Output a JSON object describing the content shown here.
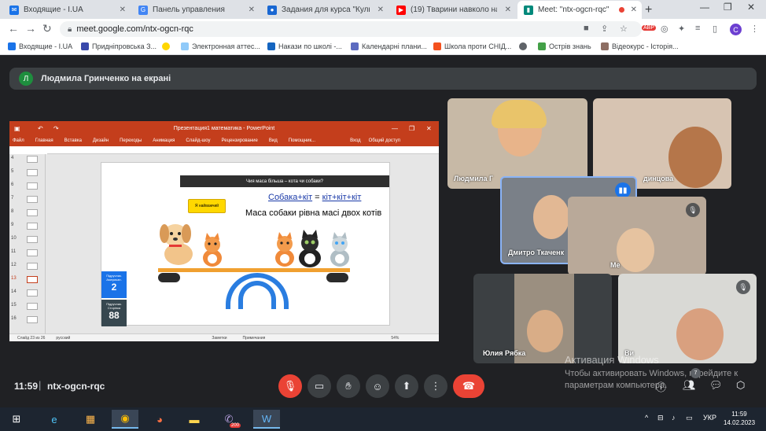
{
  "browser": {
    "tabs": [
      {
        "label": "Входящие - I.UA",
        "color": "#1a73e8",
        "active": false
      },
      {
        "label": "Панель управления",
        "color": "#4285f4",
        "active": false
      },
      {
        "label": "Задания для курса \"Культура",
        "color": "#1967d2",
        "active": false
      },
      {
        "label": "(19) Тварини навколо нас - Yo",
        "color": "#ff0000",
        "active": false
      },
      {
        "label": "Meet: \"ntx-ogcn-rqc\"",
        "color": "#00897b",
        "active": true
      }
    ],
    "new_tab": "+",
    "url": "meet.google.com/ntx-ogcn-rqc",
    "profile_initial": "C",
    "bookmarks": [
      {
        "label": "Входящие - I.UA",
        "color": "#1a73e8"
      },
      {
        "label": "Придніпровська З...",
        "color": "#3949ab"
      },
      {
        "label": "",
        "color": "#ffd600"
      },
      {
        "label": "Электронная аттес...",
        "color": "#90caf9"
      },
      {
        "label": "Накази по школі -...",
        "color": "#1565c0"
      },
      {
        "label": "Календарні плани...",
        "color": "#5c6bc0"
      },
      {
        "label": "Школа проти СНІД...",
        "color": "#f4511e"
      },
      {
        "label": "",
        "color": "#5f6368"
      },
      {
        "label": "Острів знань",
        "color": "#43a047"
      },
      {
        "label": "Відеокурс - Історія...",
        "color": "#8d6e63"
      }
    ]
  },
  "banner": {
    "initial": "Л",
    "text": "Людмила Гринченко на екрані"
  },
  "presentation": {
    "title": "Презентация1 математика - PowerPoint",
    "menu": [
      "Файл",
      "Главная",
      "Вставка",
      "Дизайн",
      "Переходы",
      "Анимация",
      "Слайд-шоу",
      "Рецензирование",
      "Вид",
      "Помощник...",
      "Вход",
      "Общий доступ"
    ],
    "thumb_numbers": [
      "4",
      "5",
      "6",
      "7",
      "8",
      "9",
      "10",
      "11",
      "12",
      "13",
      "14",
      "15",
      "16"
    ],
    "slide": {
      "header": "Чия маса більша – кота чи собаки?",
      "eq_left": "Собака+кіт",
      "eq_mid": " = ",
      "eq_right": "кіт+кіт+кіт",
      "eq_line2": "Маса собаки рівна масі двох котів",
      "bubble": "Я найважчий",
      "counter1_label": "Підручник. Американ.",
      "counter1_value": "2",
      "counter2_label": "Підручник. Сторінка",
      "counter2_value": "88"
    },
    "status": [
      "Слайд 23 из 26",
      "русский",
      "Заметки",
      "Примечания",
      "54%"
    ]
  },
  "participants": [
    {
      "name": "Людмила Г"
    },
    {
      "name": "динцова"
    },
    {
      "name": "Дмитро Ткаченк"
    },
    {
      "name": "Ме"
    },
    {
      "name": "Юлия Рябка"
    },
    {
      "name": "Ви"
    }
  ],
  "watermark": {
    "title": "Активация Windows",
    "body": "Чтобы активировать Windows, перейдите к параметрам компьютера."
  },
  "meet": {
    "time": "11:59",
    "separator": "|",
    "code": "ntx-ogcn-rqc",
    "people_count": "7"
  },
  "taskbar": {
    "lang": "УКР",
    "time": "11:59",
    "date": "14.02.2023",
    "viber_badge": "200"
  }
}
